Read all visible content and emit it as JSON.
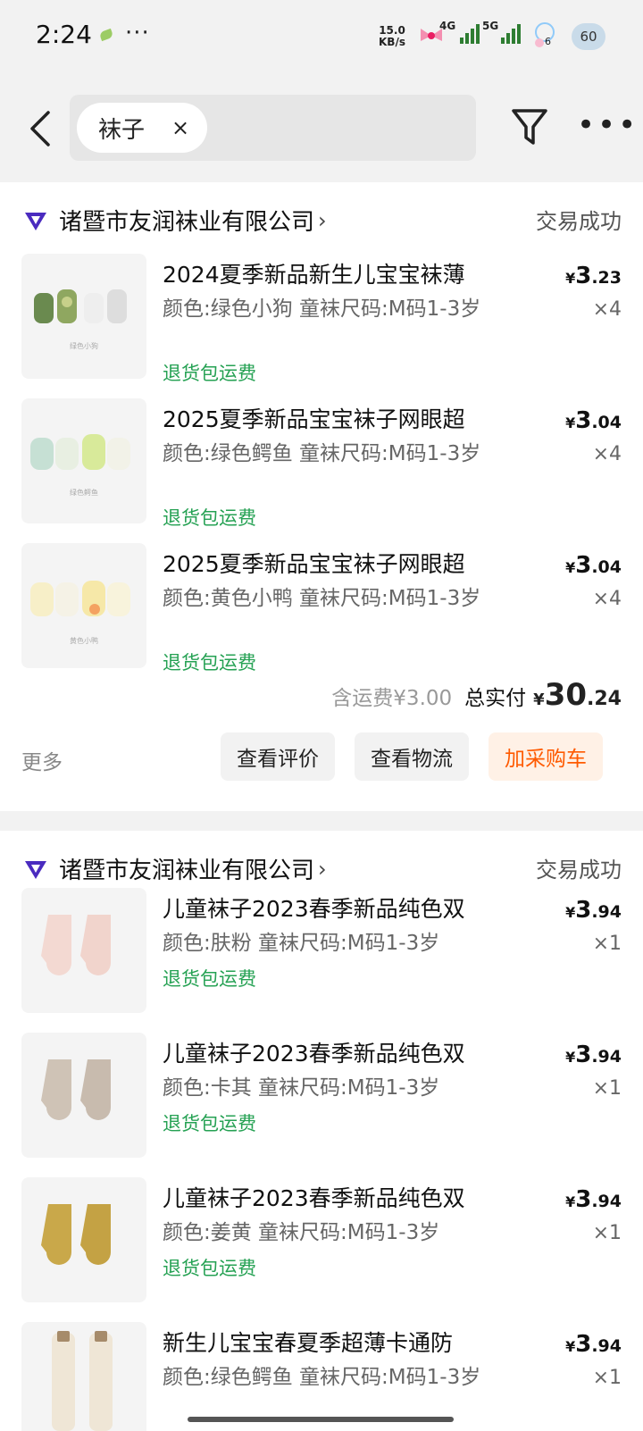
{
  "status_bar": {
    "time": "2:24",
    "notification_dots": "···",
    "net_speed_value": "15.0",
    "net_speed_unit": "KB/s",
    "net1": "4G",
    "net2": "5G",
    "bubble_count": "6",
    "battery": "60"
  },
  "header": {
    "search_chip": "袜子",
    "clear_symbol": "×",
    "more_symbol": "•••"
  },
  "orders": [
    {
      "shop_name": "诸暨市友润袜业有限公司",
      "shop_chevron": "›",
      "status": "交易成功",
      "items": [
        {
          "title": "2024夏季新品新生儿宝宝袜薄",
          "spec": "颜色:绿色小狗 童袜尺码:M码1-3岁",
          "tag": "退货包运费",
          "currency": "¥",
          "price_int": "3",
          "price_dec": ".23",
          "qty": "×4",
          "thumb_caption": "绿色小狗"
        },
        {
          "title": "2025夏季新品宝宝袜子网眼超",
          "spec": "颜色:绿色鳄鱼 童袜尺码:M码1-3岁",
          "tag": "退货包运费",
          "currency": "¥",
          "price_int": "3",
          "price_dec": ".04",
          "qty": "×4",
          "thumb_caption": "绿色鳄鱼"
        },
        {
          "title": "2025夏季新品宝宝袜子网眼超",
          "spec": "颜色:黄色小鸭 童袜尺码:M码1-3岁",
          "tag": "退货包运费",
          "currency": "¥",
          "price_int": "3",
          "price_dec": ".04",
          "qty": "×4",
          "thumb_caption": "黄色小鸭"
        }
      ],
      "shipping_text": "含运费¥3.00",
      "total_label": "总实付",
      "total_currency": "¥",
      "total_int": "30",
      "total_dec": ".24",
      "more_label": "更多",
      "buttons": [
        "查看评价",
        "查看物流",
        "加采购车"
      ]
    },
    {
      "shop_name": "诸暨市友润袜业有限公司",
      "shop_chevron": "›",
      "status": "交易成功",
      "items": [
        {
          "title": "儿童袜子2023春季新品纯色双",
          "spec": "颜色:肤粉 童袜尺码:M码1-3岁",
          "tag": "退货包运费",
          "currency": "¥",
          "price_int": "3",
          "price_dec": ".94",
          "qty": "×1"
        },
        {
          "title": "儿童袜子2023春季新品纯色双",
          "spec": "颜色:卡其 童袜尺码:M码1-3岁",
          "tag": "退货包运费",
          "currency": "¥",
          "price_int": "3",
          "price_dec": ".94",
          "qty": "×1"
        },
        {
          "title": "儿童袜子2023春季新品纯色双",
          "spec": "颜色:姜黄 童袜尺码:M码1-3岁",
          "tag": "退货包运费",
          "currency": "¥",
          "price_int": "3",
          "price_dec": ".94",
          "qty": "×1"
        },
        {
          "title": "新生儿宝宝春夏季超薄卡通防",
          "spec": "颜色:绿色鳄鱼 童袜尺码:M码1-3岁",
          "currency": "¥",
          "price_int": "3",
          "price_dec": ".94",
          "qty": "×1"
        }
      ]
    }
  ],
  "colors": {
    "accent_orange": "#ff5a00",
    "refund_green": "#25a153",
    "shop_logo": "#4a2bbf"
  }
}
